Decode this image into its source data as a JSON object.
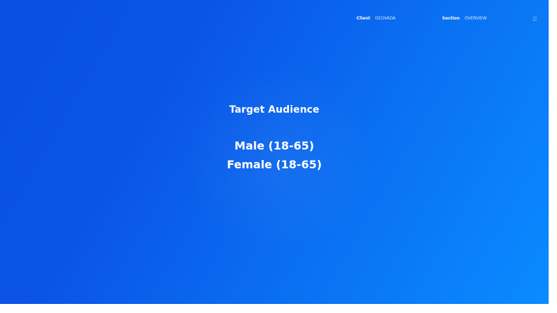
{
  "header": {
    "client_key": "Client",
    "client_value": "GEOVADA",
    "section_key": "Section",
    "section_value": "OVERVIEW"
  },
  "icons": {
    "menu": "menu-icon"
  },
  "content": {
    "title": "Target Audience",
    "items": [
      "Male (18-65)",
      "Female (18-65)"
    ]
  },
  "colors": {
    "gradient_start": "#0a4fe0",
    "gradient_end": "#0a8bff",
    "text": "#ffffff"
  }
}
